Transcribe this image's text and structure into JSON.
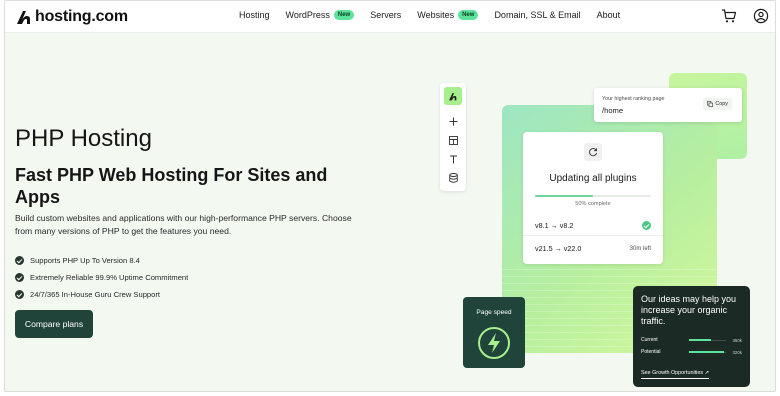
{
  "brand": {
    "name": "hosting.com",
    "accent": "#21443a",
    "new_badge_color": "#5be39b"
  },
  "nav": {
    "items": [
      {
        "label": "Hosting",
        "badge": ""
      },
      {
        "label": "WordPress",
        "badge": "New"
      },
      {
        "label": "Servers",
        "badge": ""
      },
      {
        "label": "Websites",
        "badge": "New"
      },
      {
        "label": "Domain, SSL & Email",
        "badge": ""
      },
      {
        "label": "About",
        "badge": ""
      }
    ],
    "icons": [
      "cart-icon",
      "account-icon"
    ]
  },
  "hero": {
    "title": "PHP Hosting",
    "subtitle": "Fast PHP Web Hosting For Sites and Apps",
    "description": "Build custom websites and applications with our high-performance PHP servers. Choose from many versions of PHP to get the features you need.",
    "features": [
      "Supports PHP Up To Version 8.4",
      "Extremely Reliable 99.9% Uptime Commitment",
      "24/7/365 In-House Guru Crew Support"
    ],
    "cta_label": "Compare plans"
  },
  "illustration": {
    "toolbar_icons": [
      "logo-icon",
      "plus-icon",
      "layout-icon",
      "text-icon",
      "database-icon"
    ],
    "rank_card": {
      "label": "Your highest ranking page",
      "path": "/home",
      "copy_label": "Copy"
    },
    "update_card": {
      "title": "Updating all plugins",
      "progress": 0.5,
      "progress_label": "50% complete",
      "rows": [
        {
          "versions": "v8.1 → v8.2",
          "status": "done"
        },
        {
          "versions": "v21.5 → v22.0",
          "time_left": "30m left"
        }
      ]
    },
    "speed_card": {
      "label": "Page speed",
      "icon": "lightning-icon"
    },
    "ideas_card": {
      "title": "Our ideas may help you increase your organic traffic.",
      "rows": [
        {
          "label": "Current",
          "value": "350k",
          "level": 0.6
        },
        {
          "label": "Potential",
          "value": "320k",
          "level": 0.95
        }
      ],
      "link": "See Growth Opportunities ↗"
    }
  }
}
